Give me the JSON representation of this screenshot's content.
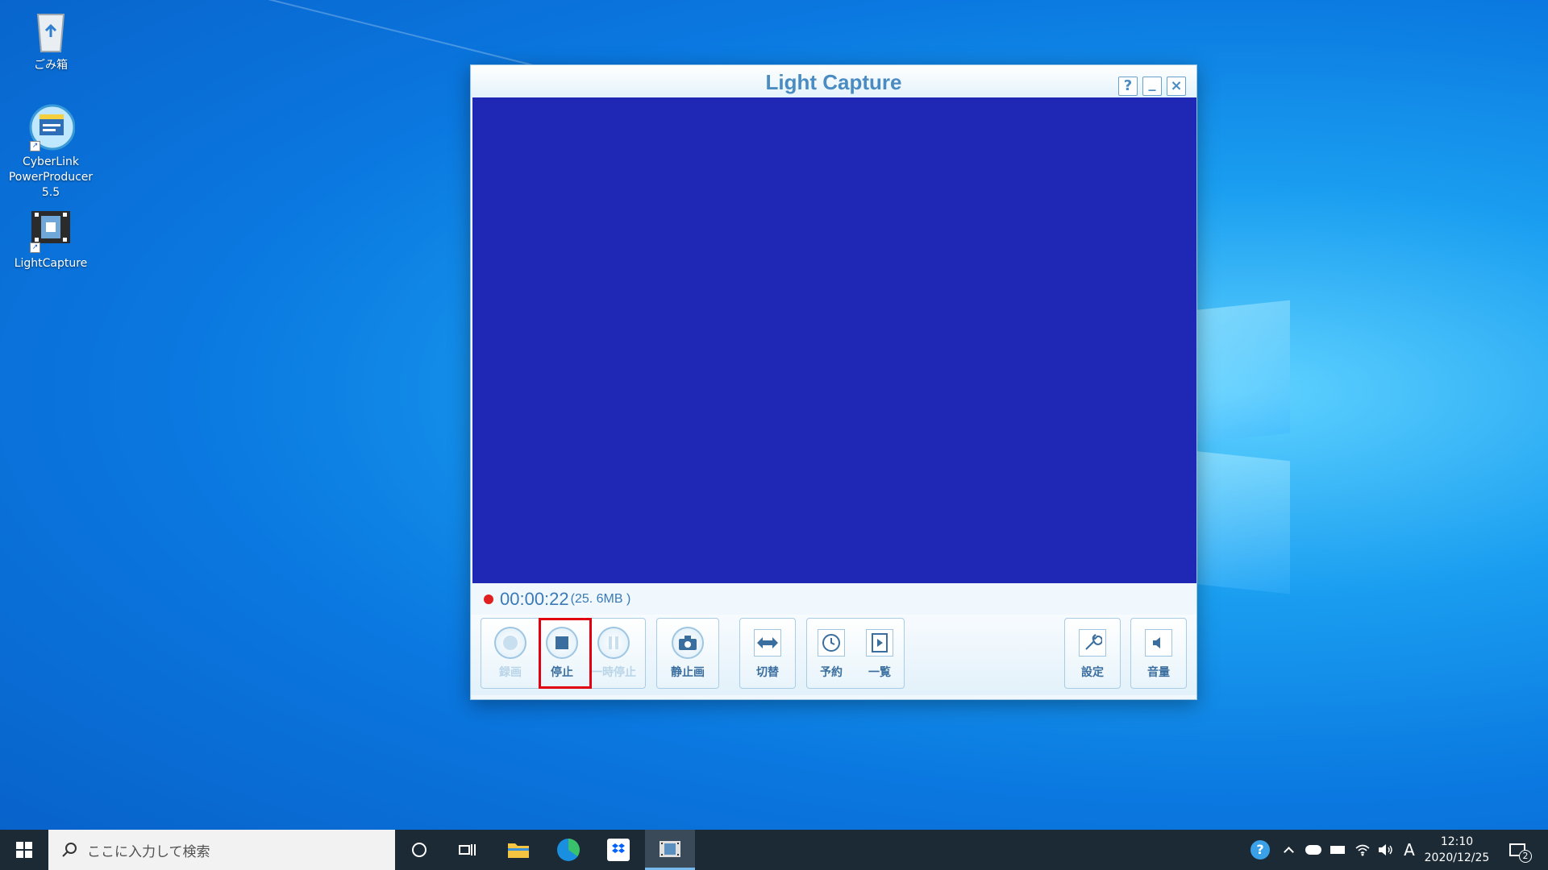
{
  "desktop": {
    "icons": [
      {
        "label": "ごみ箱"
      },
      {
        "label_line1": "CyberLink",
        "label_line2": "PowerProducer 5.5"
      },
      {
        "label": "LightCapture"
      }
    ]
  },
  "app": {
    "title": "Light Capture",
    "title_buttons": {
      "help": "?",
      "minimize": "_",
      "close": "×"
    },
    "status": {
      "time": "00:00:22",
      "size": "(25. 6MB )"
    },
    "buttons": {
      "record": "録画",
      "stop": "停止",
      "pause": "一時停止",
      "snapshot": "静止画",
      "switch": "切替",
      "schedule": "予約",
      "list": "一覧",
      "settings": "設定",
      "volume": "音量"
    },
    "preview_color": "#1e28b4"
  },
  "taskbar": {
    "search_placeholder": "ここに入力して検索",
    "ime": "A",
    "time": "12:10",
    "date": "2020/12/25",
    "notification_count": "2"
  }
}
